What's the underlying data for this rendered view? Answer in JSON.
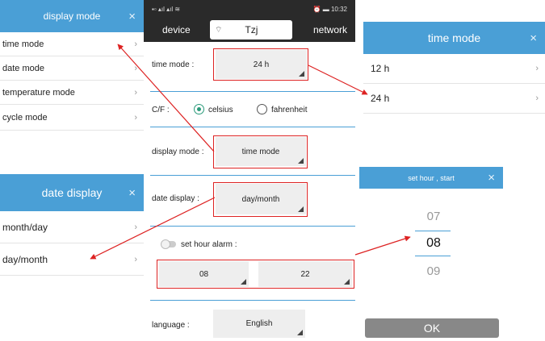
{
  "display_mode_panel": {
    "title": "display mode",
    "close": "×",
    "items": [
      {
        "label": "time mode",
        "chev": "›"
      },
      {
        "label": "date mode",
        "chev": "›"
      },
      {
        "label": "temperature mode",
        "chev": "›"
      },
      {
        "label": "cycle mode",
        "chev": "›"
      }
    ]
  },
  "date_display_panel": {
    "title": "date display",
    "close": "×",
    "items": [
      {
        "label": "month/day",
        "chev": "›"
      },
      {
        "label": "day/month",
        "chev": "›"
      }
    ]
  },
  "phone": {
    "status_time": "10:32",
    "nav": {
      "device": "device",
      "center": "Tzj",
      "network": "network"
    },
    "time_mode": {
      "label": "time mode :",
      "value": "24 h"
    },
    "cf": {
      "label": "C/F :",
      "opt1": "celsius",
      "opt2": "fahrenheit",
      "selected": "celsius"
    },
    "display_mode": {
      "label": "display mode :",
      "value": "time mode"
    },
    "date_display": {
      "label": "date display :",
      "value": "day/month"
    },
    "hour_alarm": {
      "label": "set hour alarm :",
      "start": "08",
      "end": "22",
      "enabled": false
    },
    "language": {
      "label": "language :",
      "value": "English"
    }
  },
  "time_mode_panel": {
    "title": "time mode",
    "close": "×",
    "items": [
      {
        "label": "12 h",
        "chev": "›"
      },
      {
        "label": "24 h",
        "chev": "›"
      }
    ]
  },
  "set_hour_panel": {
    "title": "set hour , start",
    "close": "×",
    "values": [
      "07",
      "08",
      "09"
    ],
    "selected": "08",
    "ok": "OK"
  },
  "colors": {
    "header": "#4a9fd6",
    "annotation": "#d22",
    "navbar": "#2a2a2a",
    "radio_on": "#2a9a7a"
  }
}
